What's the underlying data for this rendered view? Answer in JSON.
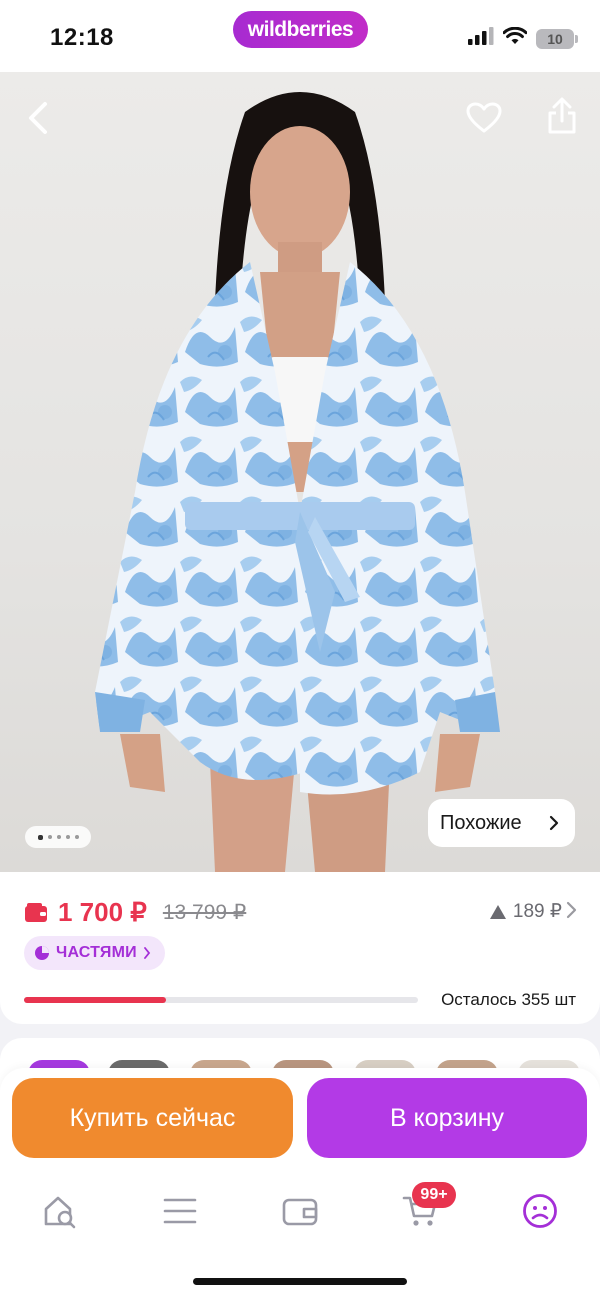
{
  "status_bar": {
    "time": "12:18",
    "brand": "wildberries",
    "battery": "10"
  },
  "product": {
    "similar_label": "Похожие",
    "image_count": 5,
    "active_image": 1,
    "image_description": "woman wearing blue floral toile print satin kimono robe with belt and shorts"
  },
  "price": {
    "current": "1 700 ₽",
    "old": "13 799 ₽",
    "delta": "189 ₽",
    "installments_label": "ЧАСТЯМИ",
    "remaining_label": "Осталось 355 шт",
    "stock_fraction": 0.36
  },
  "actions": {
    "buy_now": "Купить сейчас",
    "add_to_cart": "В корзину"
  },
  "tabbar": {
    "cart_badge": "99+",
    "items": [
      "home-search",
      "catalog",
      "wallet",
      "cart",
      "profile"
    ],
    "active": "profile"
  },
  "colors": {
    "accent_purple": "#b33ae6",
    "accent_orange": "#f08a2e",
    "price_red": "#e8344f"
  }
}
